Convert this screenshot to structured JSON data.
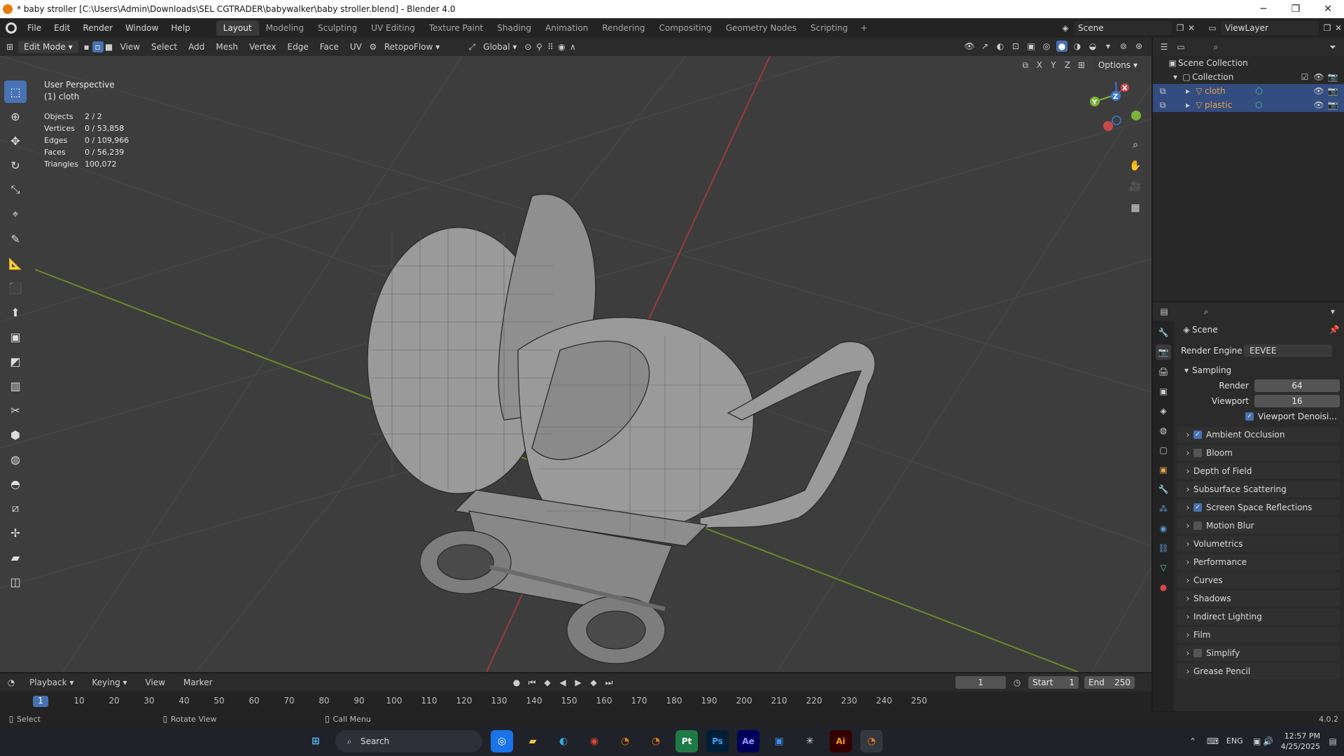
{
  "window": {
    "title": "* baby stroller [C:\\Users\\Admin\\Downloads\\SEL CGTRADER\\babywalker\\baby stroller.blend] - Blender 4.0"
  },
  "menu": [
    "File",
    "Edit",
    "Render",
    "Window",
    "Help"
  ],
  "workspaces": [
    "Layout",
    "Modeling",
    "Sculpting",
    "UV Editing",
    "Texture Paint",
    "Shading",
    "Animation",
    "Rendering",
    "Compositing",
    "Geometry Nodes",
    "Scripting"
  ],
  "active_workspace": "Layout",
  "scene_field": "Scene",
  "viewlayer_field": "ViewLayer",
  "header3d": {
    "mode": "Edit Mode",
    "items": [
      "View",
      "Select",
      "Add",
      "Mesh",
      "Vertex",
      "Edge",
      "Face",
      "UV"
    ],
    "addon": "RetopoFlow",
    "orientation": "Global",
    "options": "Options",
    "axes": [
      "X",
      "Y",
      "Z"
    ]
  },
  "viewport": {
    "perspective": "User Perspective",
    "object": "(1) cloth",
    "stats": [
      {
        "k": "Objects",
        "v": "2 / 2"
      },
      {
        "k": "Vertices",
        "v": "0 / 53,858"
      },
      {
        "k": "Edges",
        "v": "0 / 109,966"
      },
      {
        "k": "Faces",
        "v": "0 / 56,239"
      },
      {
        "k": "Triangles",
        "v": "100,072"
      }
    ],
    "gizmo_axes": [
      "X",
      "Y",
      "Z"
    ]
  },
  "outliner": {
    "root": "Scene Collection",
    "collection": "Collection",
    "objects": [
      {
        "name": "cloth",
        "color": "#e8a24a"
      },
      {
        "name": "plastic",
        "color": "#e8a24a"
      }
    ]
  },
  "properties": {
    "scene_label": "Scene",
    "render_engine_label": "Render Engine",
    "render_engine_value": "EEVEE",
    "sampling": "Sampling",
    "render_label": "Render",
    "render_value": "64",
    "viewport_label": "Viewport",
    "viewport_value": "16",
    "denoise_label": "Viewport Denoisi...",
    "panels": [
      {
        "label": "Ambient Occlusion",
        "check": true
      },
      {
        "label": "Bloom",
        "check": false
      },
      {
        "label": "Depth of Field",
        "check": null
      },
      {
        "label": "Subsurface Scattering",
        "check": null
      },
      {
        "label": "Screen Space Reflections",
        "check": true
      },
      {
        "label": "Motion Blur",
        "check": false
      },
      {
        "label": "Volumetrics",
        "check": null
      },
      {
        "label": "Performance",
        "check": null
      },
      {
        "label": "Curves",
        "check": null
      },
      {
        "label": "Shadows",
        "check": null
      },
      {
        "label": "Indirect Lighting",
        "check": null
      },
      {
        "label": "Film",
        "check": null
      },
      {
        "label": "Simplify",
        "check": false
      },
      {
        "label": "Grease Pencil",
        "check": null
      }
    ]
  },
  "timeline": {
    "menus": [
      "Playback",
      "Keying",
      "View",
      "Marker"
    ],
    "current_frame": "1",
    "start_label": "Start",
    "start_value": "1",
    "end_label": "End",
    "end_value": "250",
    "ticks": [
      "1",
      "10",
      "20",
      "30",
      "40",
      "50",
      "60",
      "70",
      "80",
      "90",
      "100",
      "110",
      "120",
      "130",
      "140",
      "150",
      "160",
      "170",
      "180",
      "190",
      "200",
      "210",
      "220",
      "230",
      "240",
      "250"
    ]
  },
  "statusbar": {
    "select": "Select",
    "rotate": "Rotate View",
    "call_menu": "Call Menu",
    "version": "4.0.2"
  },
  "taskbar": {
    "search": "Search",
    "lang": "ENG",
    "time": "12:57 PM",
    "date": "4/25/2025"
  }
}
